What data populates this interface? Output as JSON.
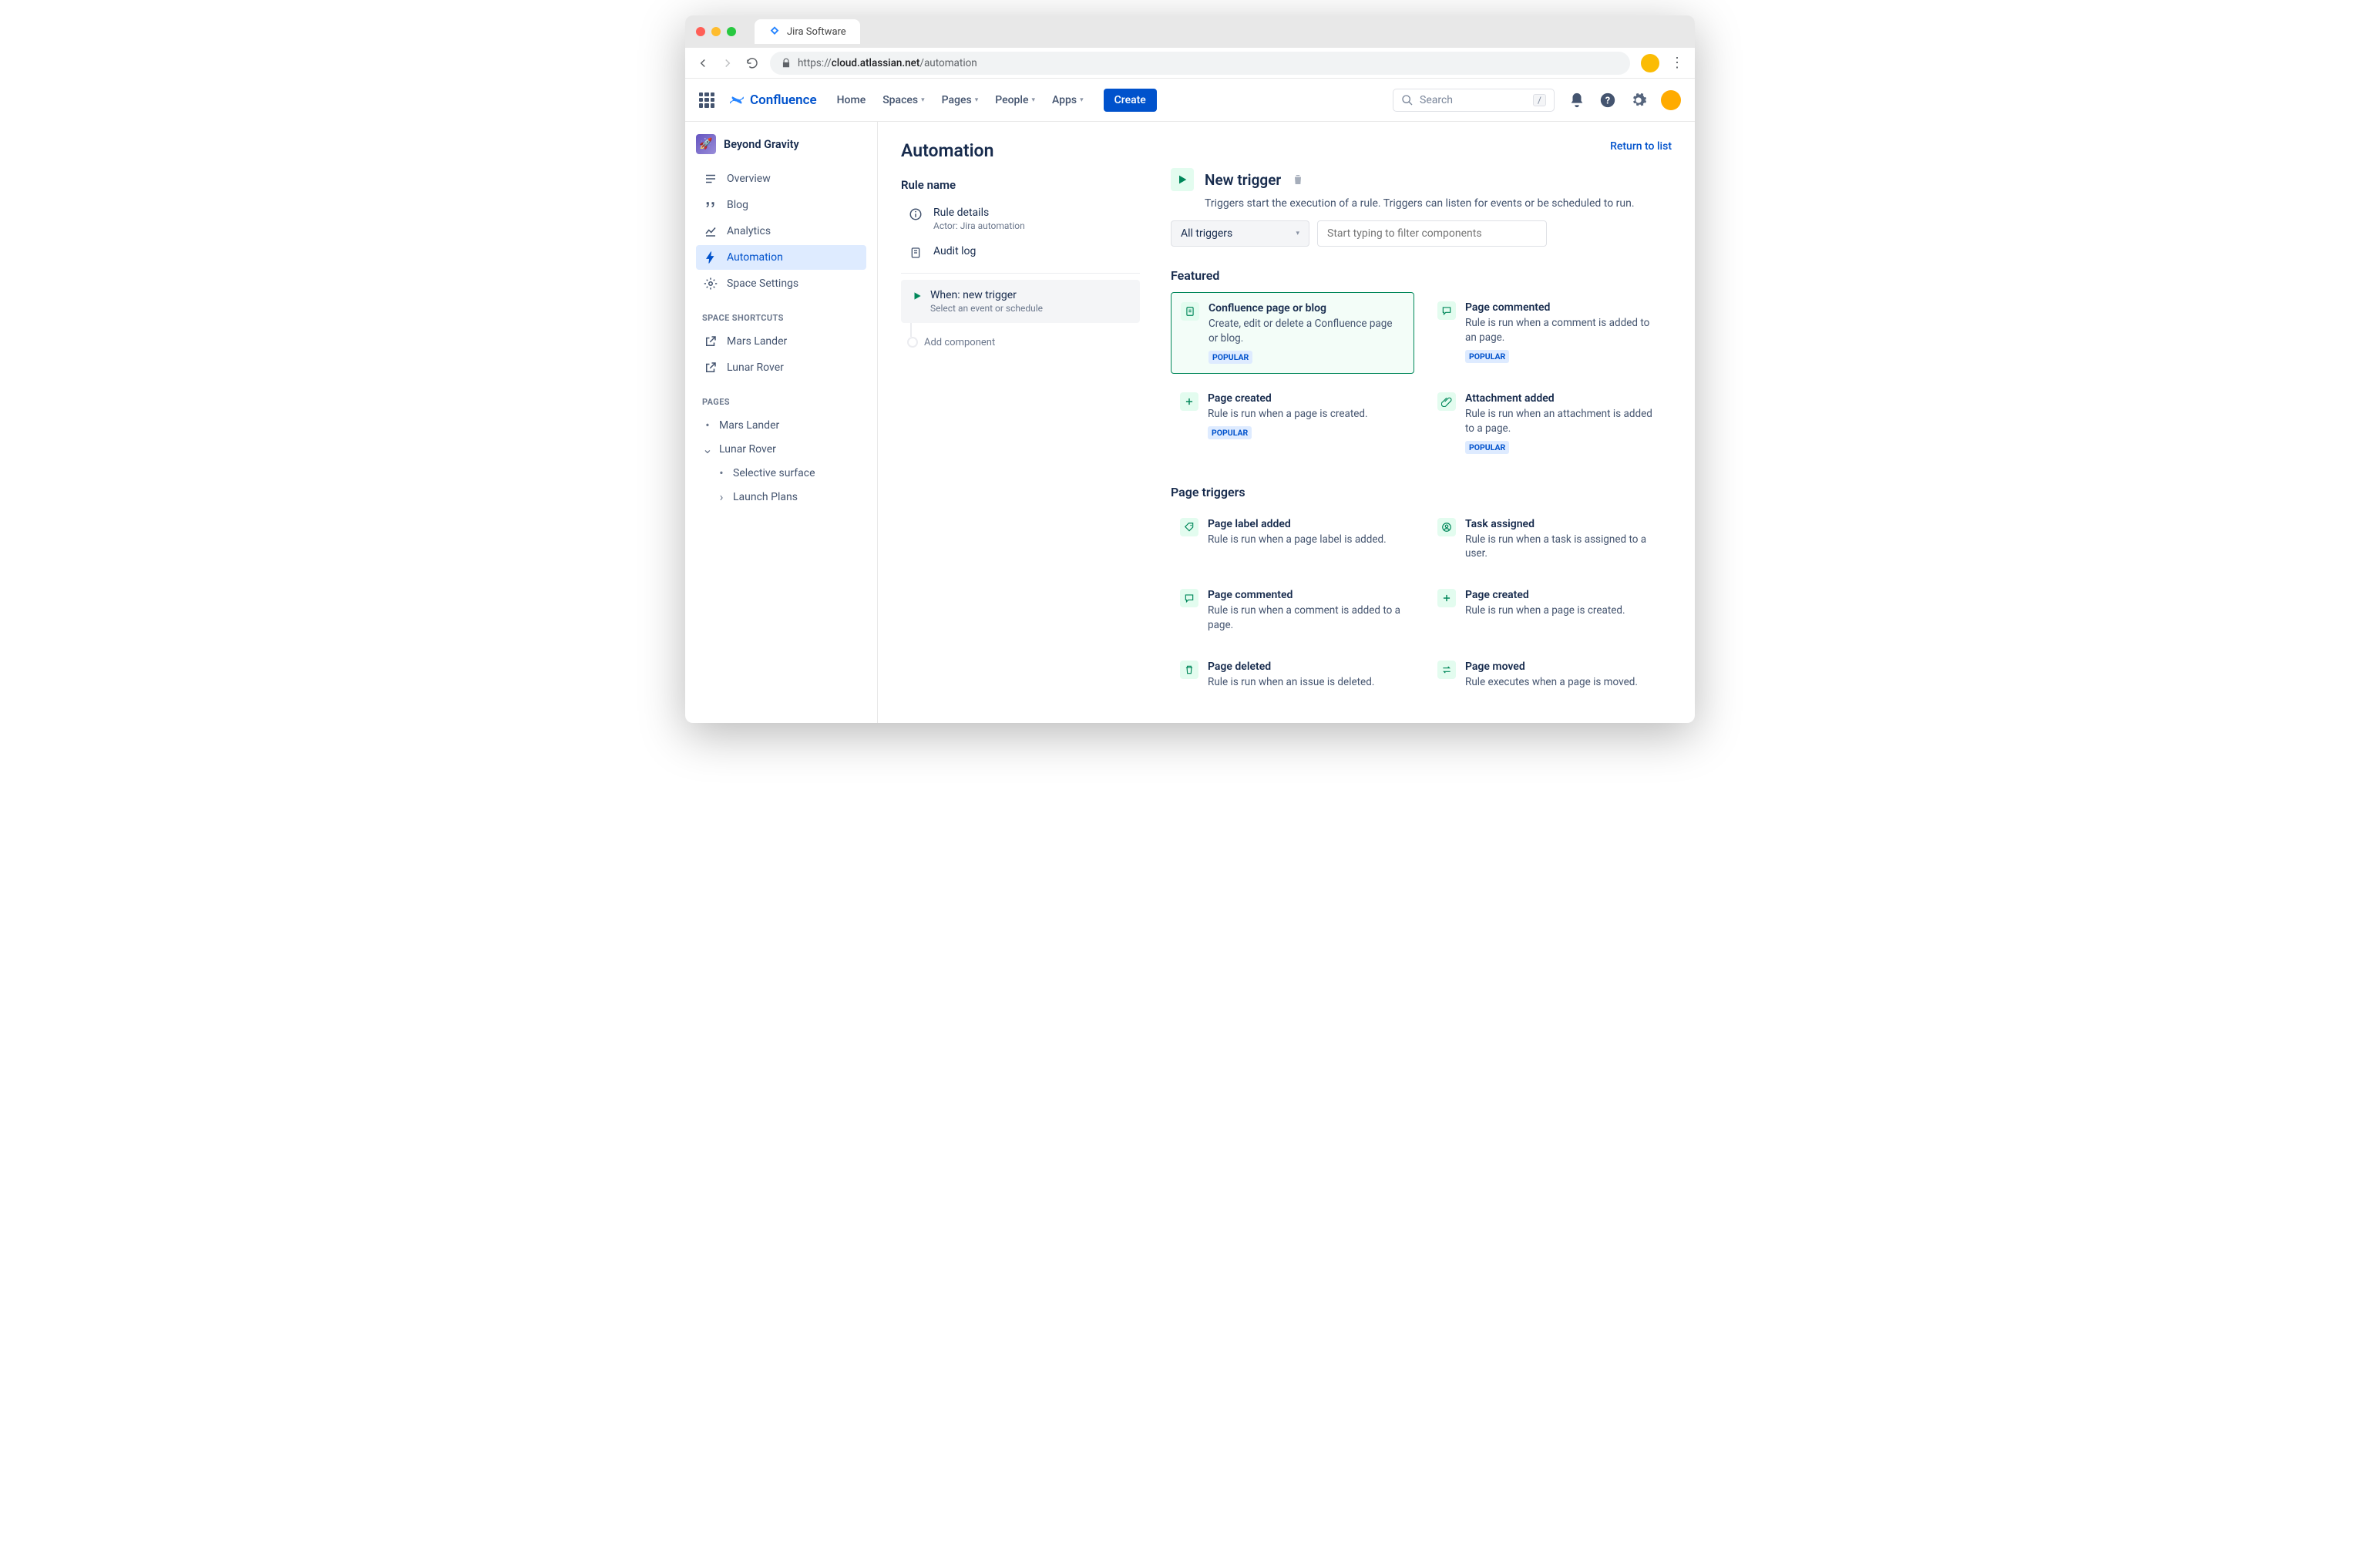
{
  "browser": {
    "tab_title": "Jira Software",
    "url_prefix": "https://",
    "url_host": "cloud.atlassian.net",
    "url_path": "/automation"
  },
  "topnav": {
    "product": "Confluence",
    "items": [
      "Home",
      "Spaces",
      "Pages",
      "People",
      "Apps"
    ],
    "create": "Create",
    "search_placeholder": "Search",
    "slash": "/"
  },
  "sidebar": {
    "space": "Beyond Gravity",
    "nav": [
      {
        "label": "Overview",
        "icon": "list"
      },
      {
        "label": "Blog",
        "icon": "quote"
      },
      {
        "label": "Analytics",
        "icon": "chart"
      },
      {
        "label": "Automation",
        "icon": "bolt",
        "active": true
      },
      {
        "label": "Space Settings",
        "icon": "gear"
      }
    ],
    "shortcuts_label": "SPACE SHORTCUTS",
    "shortcuts": [
      "Mars Lander",
      "Lunar Rover"
    ],
    "pages_label": "PAGES",
    "pages": [
      {
        "label": "Mars Lander",
        "bullet": "•"
      },
      {
        "label": "Lunar Rover",
        "bullet": "⌄"
      },
      {
        "label": "Selective surface",
        "bullet": "•",
        "sub": true
      },
      {
        "label": "Launch Plans",
        "bullet": "›",
        "sub": true
      }
    ]
  },
  "main": {
    "title": "Automation",
    "return": "Return to list",
    "rule_name_label": "Rule name",
    "rule_details": "Rule details",
    "rule_actor": "Actor: Jira automation",
    "audit_log": "Audit log",
    "when_title": "When: new trigger",
    "when_sub": "Select an event or schedule",
    "add_component": "Add component",
    "trigger_title": "New trigger",
    "trigger_desc": "Triggers start the execution of a rule. Triggers can listen for events or be scheduled to run.",
    "select_value": "All triggers",
    "filter_placeholder": "Start typing to filter components",
    "featured_label": "Featured",
    "popular": "POPULAR",
    "featured": [
      {
        "title": "Confluence page or blog",
        "desc": "Create, edit or delete a Confluence page or blog.",
        "popular": true,
        "icon": "page",
        "selected": true
      },
      {
        "title": "Page commented",
        "desc": "Rule is run when a comment is added to an page.",
        "popular": true,
        "icon": "comment"
      },
      {
        "title": "Page created",
        "desc": "Rule is run when a page is created.",
        "popular": true,
        "icon": "plus"
      },
      {
        "title": "Attachment added",
        "desc": "Rule is run when an attachment is added to a page.",
        "popular": true,
        "icon": "clip"
      }
    ],
    "page_triggers_label": "Page triggers",
    "page_triggers": [
      {
        "title": "Page label added",
        "desc": "Rule is run when a page label is added.",
        "icon": "tag"
      },
      {
        "title": "Task assigned",
        "desc": "Rule is run when a task is assigned to a user.",
        "icon": "user"
      },
      {
        "title": "Page commented",
        "desc": "Rule is run when a comment is added to a page.",
        "icon": "comment"
      },
      {
        "title": "Page created",
        "desc": "Rule is run when a page is created.",
        "icon": "plus"
      },
      {
        "title": "Page deleted",
        "desc": "Rule is run when an issue is deleted.",
        "icon": "trash"
      },
      {
        "title": "Page moved",
        "desc": "Rule executes when a page is moved.",
        "icon": "swap"
      }
    ]
  }
}
